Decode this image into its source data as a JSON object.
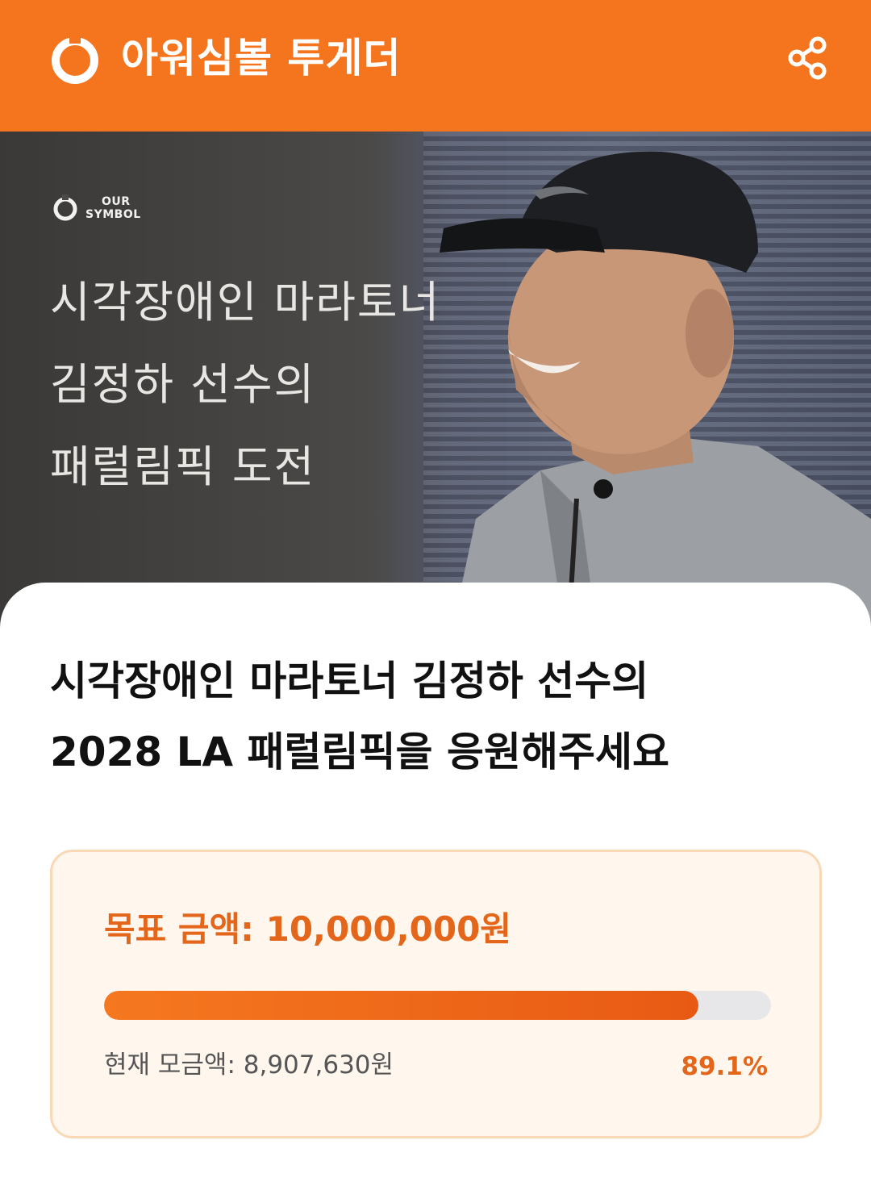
{
  "header": {
    "title": "아워심볼 투게더",
    "logo_icon": "ring-logo-icon",
    "share_icon": "share-icon"
  },
  "hero": {
    "brand_line1": "OUR",
    "brand_line2": "SYMBOL",
    "lines": [
      "시각장애인 마라토너",
      "김정하 선수의",
      "패럴림픽 도전"
    ]
  },
  "campaign": {
    "title_line1": "시각장애인 마라토너 김정하 선수의",
    "title_line2": "2028 LA 패럴림픽을 응원해주세요"
  },
  "funding": {
    "goal_label": "목표 금액: 10,000,000원",
    "current_label": "현재 모금액: 8,907,630원",
    "percent_label": "89.1%",
    "progress_fraction": 0.891
  },
  "colors": {
    "brand_orange": "#f5751f",
    "accent_text": "#e4661a",
    "card_bg": "#fff7ee"
  }
}
